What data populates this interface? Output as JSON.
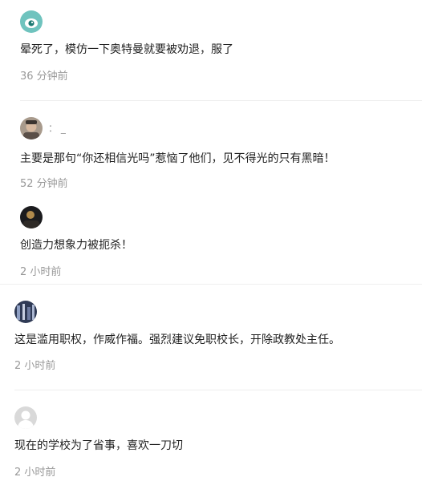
{
  "comments": [
    {
      "avatar": "teal-eye-avatar",
      "username": "",
      "text": "晕死了，模仿一下奥特曼就要被劝退，服了",
      "time": "36 分钟前"
    },
    {
      "avatar": "photo-avatar-man",
      "username": "：  _",
      "text": "主要是那句“你还相信光吗”惹恼了他们，见不得光的只有黑暗！",
      "time": "52 分钟前"
    },
    {
      "avatar": "dark-photo-avatar",
      "username": "",
      "text": "创造力想象力被扼杀！",
      "time": "2 小时前"
    },
    {
      "avatar": "dark-blue-photo-avatar",
      "username": "",
      "text": "这是滥用职权，作威作福。强烈建议免职校长，开除政教处主任。",
      "time": "2 小时前"
    },
    {
      "avatar": "default-gray-avatar",
      "username": "",
      "text": "现在的学校为了省事，喜欢一刀切",
      "time": "2 小时前"
    }
  ],
  "colors": {
    "text": "#222222",
    "meta": "#999999",
    "divider": "#eeeeee"
  }
}
